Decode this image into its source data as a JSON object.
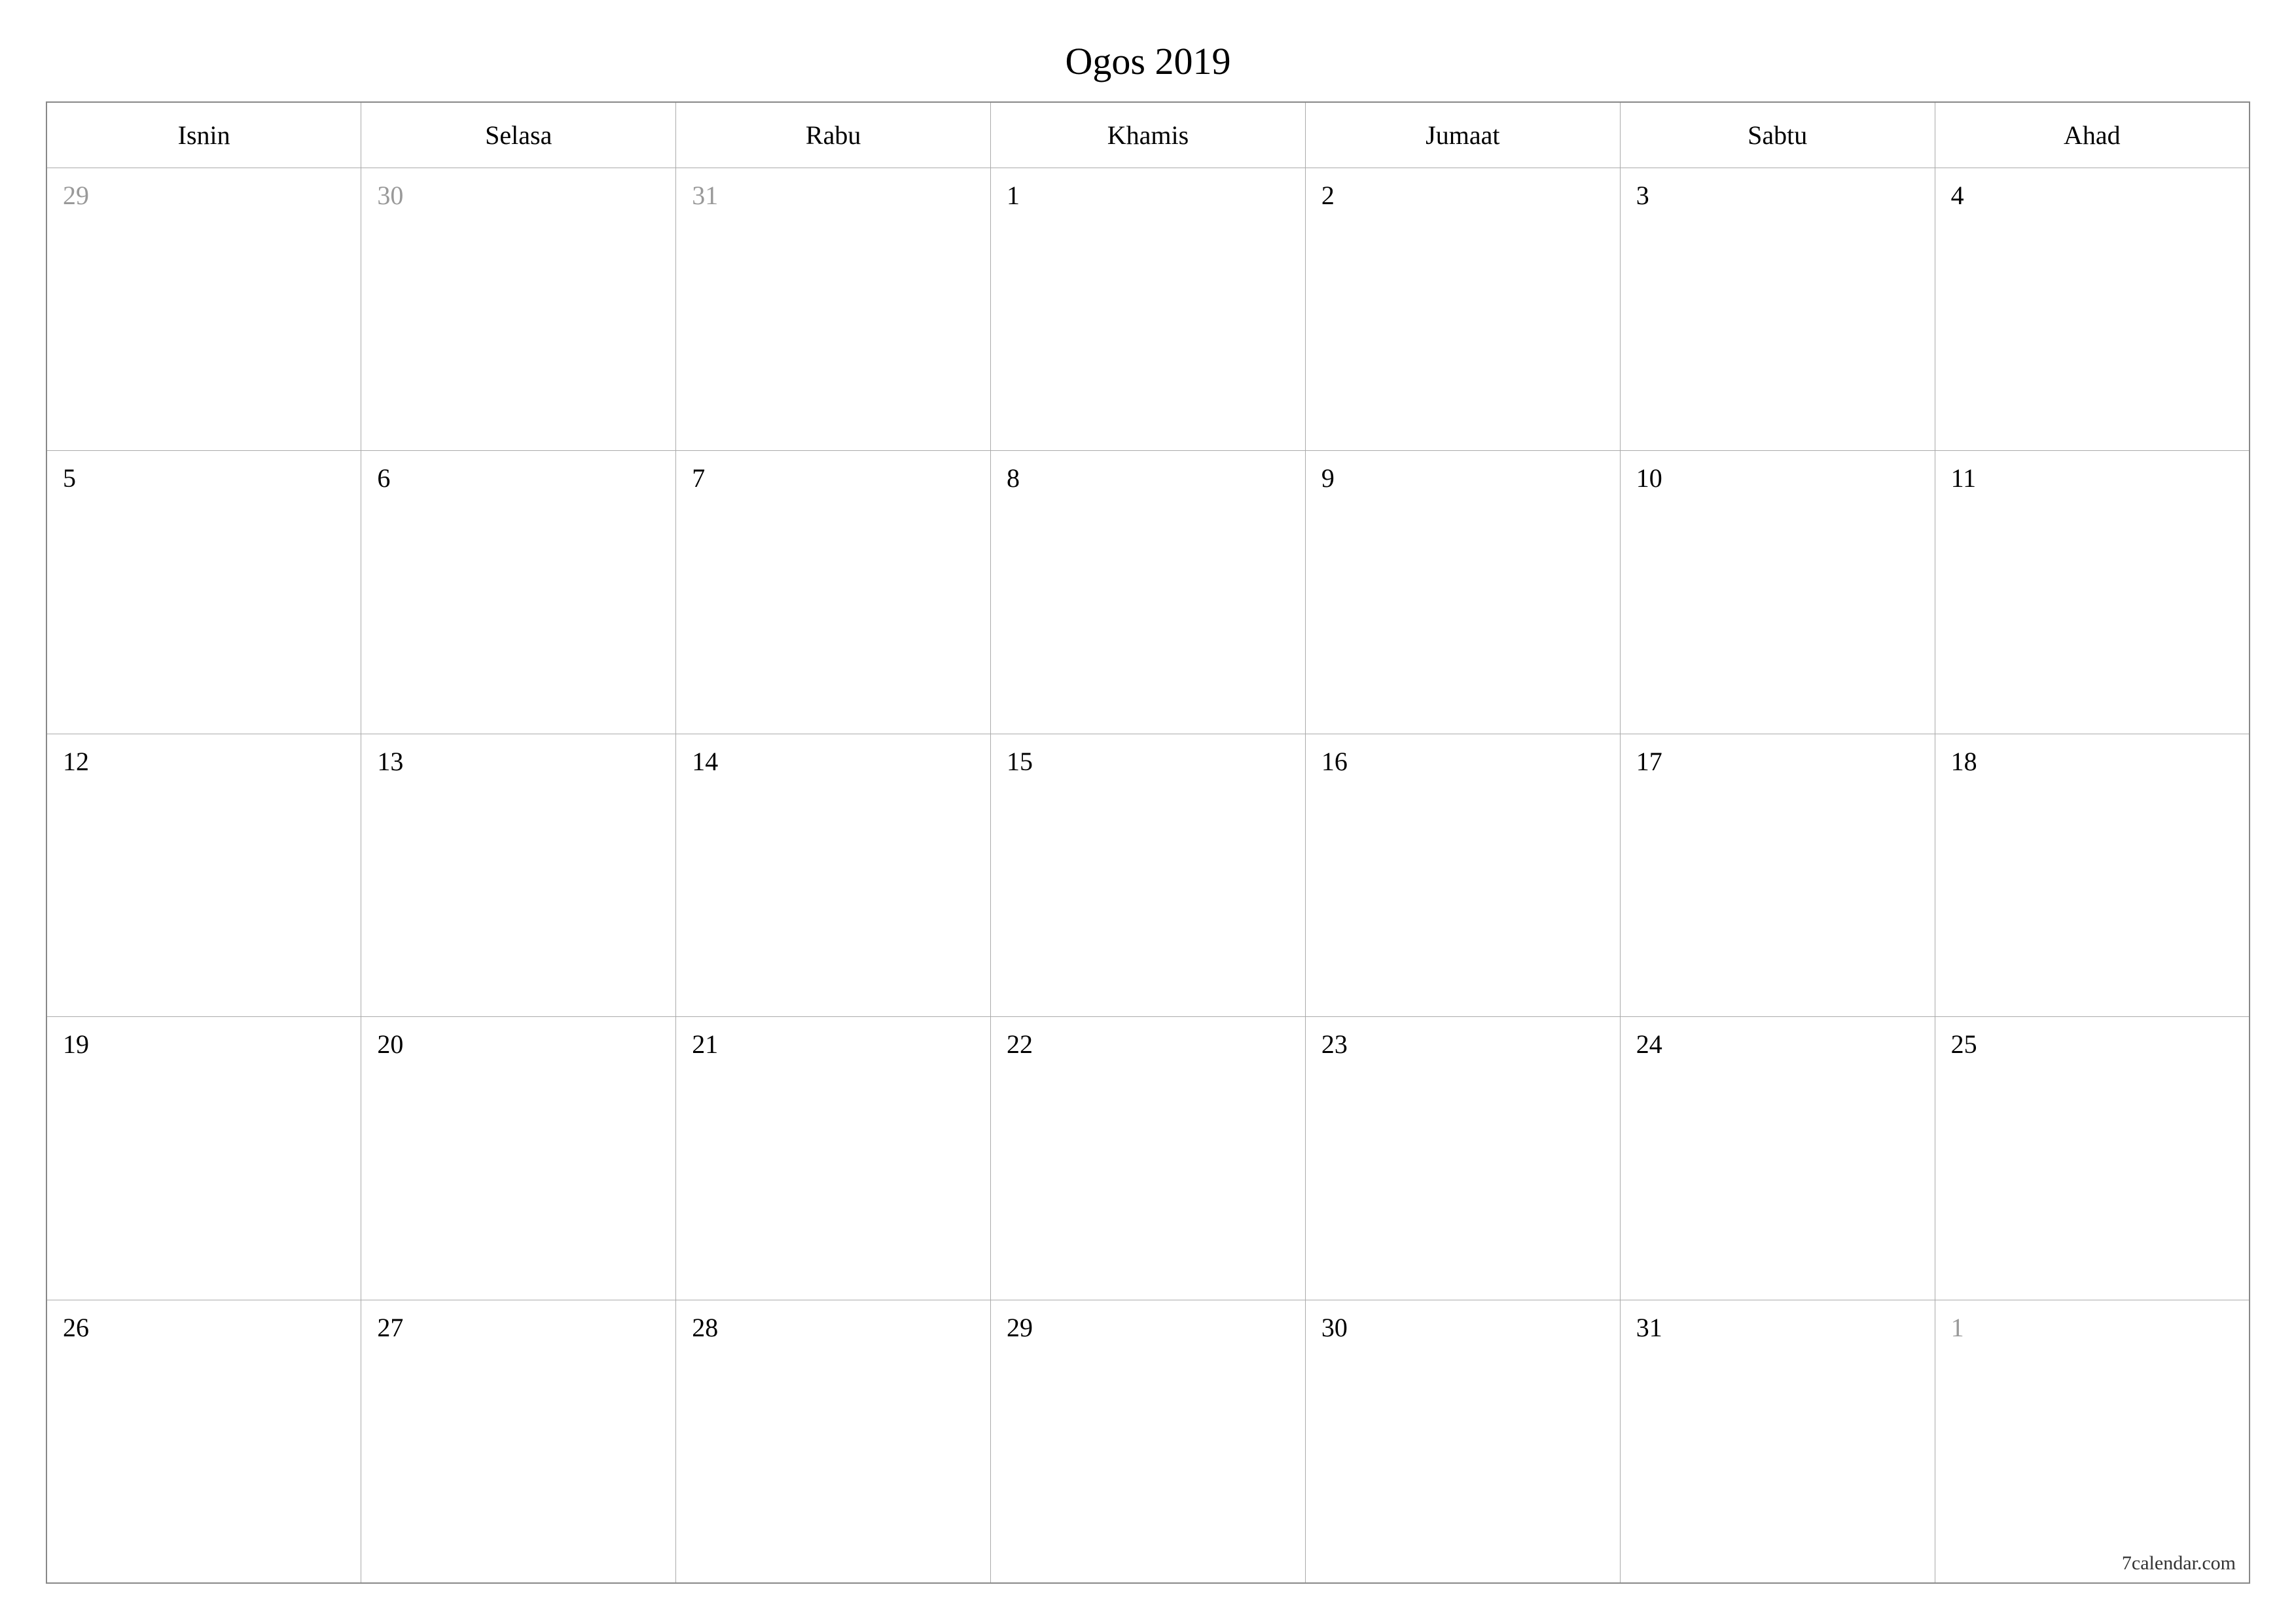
{
  "title": "Ogos 2019",
  "weekdays": [
    "Isnin",
    "Selasa",
    "Rabu",
    "Khamis",
    "Jumaat",
    "Sabtu",
    "Ahad"
  ],
  "weeks": [
    [
      {
        "day": "29",
        "other": true
      },
      {
        "day": "30",
        "other": true
      },
      {
        "day": "31",
        "other": true
      },
      {
        "day": "1",
        "other": false
      },
      {
        "day": "2",
        "other": false
      },
      {
        "day": "3",
        "other": false
      },
      {
        "day": "4",
        "other": false
      }
    ],
    [
      {
        "day": "5",
        "other": false
      },
      {
        "day": "6",
        "other": false
      },
      {
        "day": "7",
        "other": false
      },
      {
        "day": "8",
        "other": false
      },
      {
        "day": "9",
        "other": false
      },
      {
        "day": "10",
        "other": false
      },
      {
        "day": "11",
        "other": false
      }
    ],
    [
      {
        "day": "12",
        "other": false
      },
      {
        "day": "13",
        "other": false
      },
      {
        "day": "14",
        "other": false
      },
      {
        "day": "15",
        "other": false
      },
      {
        "day": "16",
        "other": false
      },
      {
        "day": "17",
        "other": false
      },
      {
        "day": "18",
        "other": false
      }
    ],
    [
      {
        "day": "19",
        "other": false
      },
      {
        "day": "20",
        "other": false
      },
      {
        "day": "21",
        "other": false
      },
      {
        "day": "22",
        "other": false
      },
      {
        "day": "23",
        "other": false
      },
      {
        "day": "24",
        "other": false
      },
      {
        "day": "25",
        "other": false
      }
    ],
    [
      {
        "day": "26",
        "other": false
      },
      {
        "day": "27",
        "other": false
      },
      {
        "day": "28",
        "other": false
      },
      {
        "day": "29",
        "other": false
      },
      {
        "day": "30",
        "other": false
      },
      {
        "day": "31",
        "other": false
      },
      {
        "day": "1",
        "other": true
      }
    ]
  ],
  "footer": "7calendar.com"
}
